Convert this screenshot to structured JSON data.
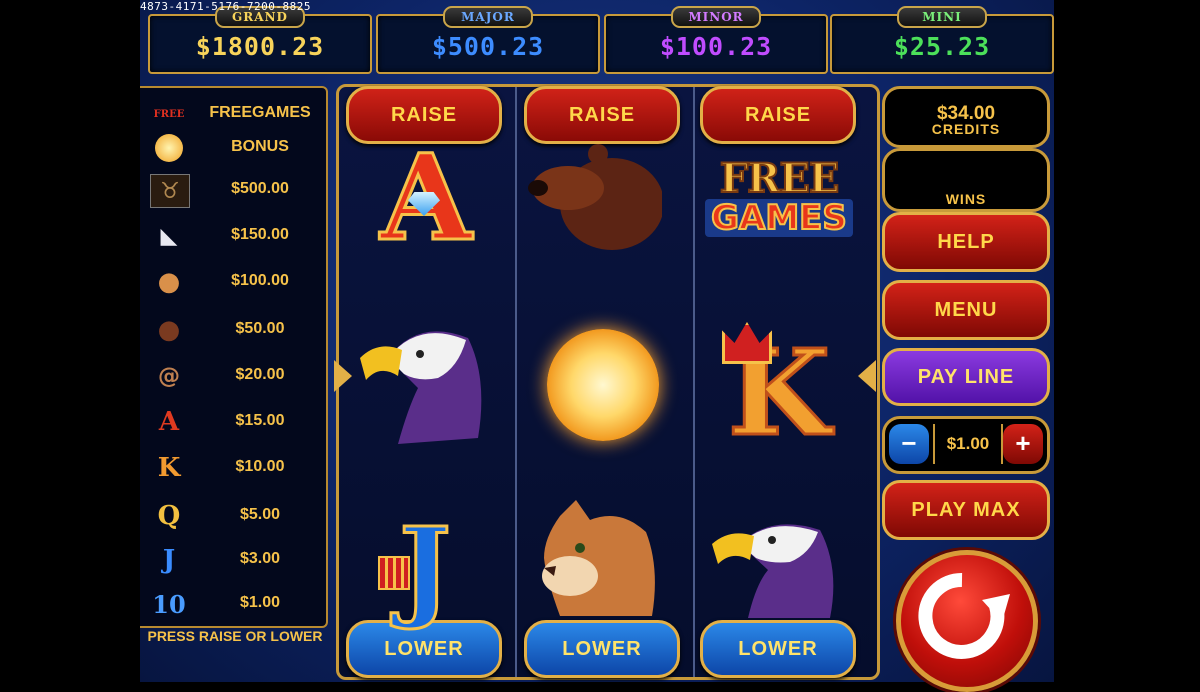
{
  "serial": "4873-4171-5176-7200-8825",
  "jackpots": [
    {
      "label": "GRAND",
      "amount": "$1800.23",
      "color": "#f7d35a"
    },
    {
      "label": "MAJOR",
      "amount": "$500.23",
      "color": "#3d8cff"
    },
    {
      "label": "MINOR",
      "amount": "$100.23",
      "color": "#c04cff"
    },
    {
      "label": "MINI",
      "amount": "$25.23",
      "color": "#4ce05a"
    }
  ],
  "paytable": [
    {
      "icon": "free-games-icon",
      "glyph": "FREE",
      "value": "FREEGAMES"
    },
    {
      "icon": "sun-coin-icon",
      "glyph": "●",
      "value": "BONUS"
    },
    {
      "icon": "buffalo-icon",
      "glyph": "♉",
      "value": "$500.00"
    },
    {
      "icon": "eagle-icon",
      "glyph": "◣",
      "value": "$150.00"
    },
    {
      "icon": "cougar-icon",
      "glyph": "●",
      "value": "$100.00"
    },
    {
      "icon": "bear-icon",
      "glyph": "●",
      "value": "$50.00"
    },
    {
      "icon": "ram-icon",
      "glyph": "@",
      "value": "$20.00"
    },
    {
      "icon": "ace-icon",
      "glyph": "A",
      "value": "$15.00"
    },
    {
      "icon": "king-icon",
      "glyph": "K",
      "value": "$10.00"
    },
    {
      "icon": "queen-icon",
      "glyph": "Q",
      "value": "$5.00"
    },
    {
      "icon": "jack-icon",
      "glyph": "J",
      "value": "$3.00"
    },
    {
      "icon": "ten-icon",
      "glyph": "10",
      "value": "$1.00"
    }
  ],
  "instruction": "PRESS RAISE OR LOWER",
  "reel_buttons": {
    "raise": "RAISE",
    "lower": "LOWER"
  },
  "reels": [
    [
      "ace-symbol",
      "eagle-symbol",
      "jack-symbol"
    ],
    [
      "bear-symbol",
      "sun-bonus-symbol",
      "cougar-symbol"
    ],
    [
      "free-games-symbol",
      "king-symbol",
      "eagle-symbol"
    ]
  ],
  "free_games_text": {
    "line1": "FREE",
    "line2": "GAMES"
  },
  "credits": {
    "amount": "$34.00",
    "label": "CREDITS"
  },
  "wins": {
    "amount": "",
    "label": "WINS"
  },
  "buttons": {
    "help": "HELP",
    "menu": "MENU",
    "pay_line": "PAY LINE",
    "play_max": "PLAY MAX"
  },
  "bet": {
    "minus": "−",
    "value": "$1.00",
    "plus": "+"
  }
}
